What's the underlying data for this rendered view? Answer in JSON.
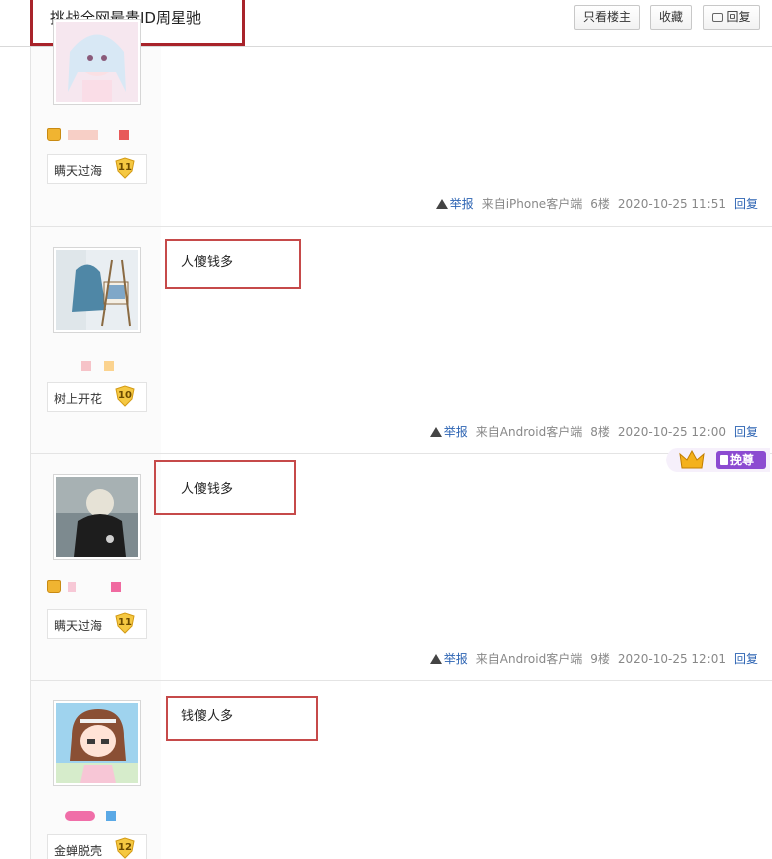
{
  "thread": {
    "title": "挑战全网最贵ID周星驰",
    "buttons": {
      "only_op": "只看楼主",
      "favorite": "收藏",
      "reply": "回复"
    }
  },
  "posts": [
    {
      "username": "瞒天过海",
      "level": "11",
      "content": "",
      "report": "举报",
      "source": "来自iPhone客户端",
      "floor": "6楼",
      "time": "2020-10-25 11:51",
      "reply": "回复"
    },
    {
      "username": "树上开花",
      "level": "10",
      "content": "人傻钱多",
      "report": "举报",
      "source": "来自Android客户端",
      "floor": "8楼",
      "time": "2020-10-25 12:00",
      "reply": "回复"
    },
    {
      "username": "瞒天过海",
      "level": "11",
      "content": "人傻钱多",
      "report": "举报",
      "source": "来自Android客户端",
      "floor": "9楼",
      "time": "2020-10-25 12:01",
      "reply": "回复"
    },
    {
      "username": "金蝉脱壳",
      "level": "12",
      "content": "钱傻人多"
    }
  ],
  "promo_badge": {
    "label": "挽尊",
    "icon": "crown-icon"
  },
  "colors": {
    "highlight": "#c64a4a",
    "title_box": "#a8232a",
    "link": "#2d64b3",
    "badge": "#8c4bd1"
  }
}
